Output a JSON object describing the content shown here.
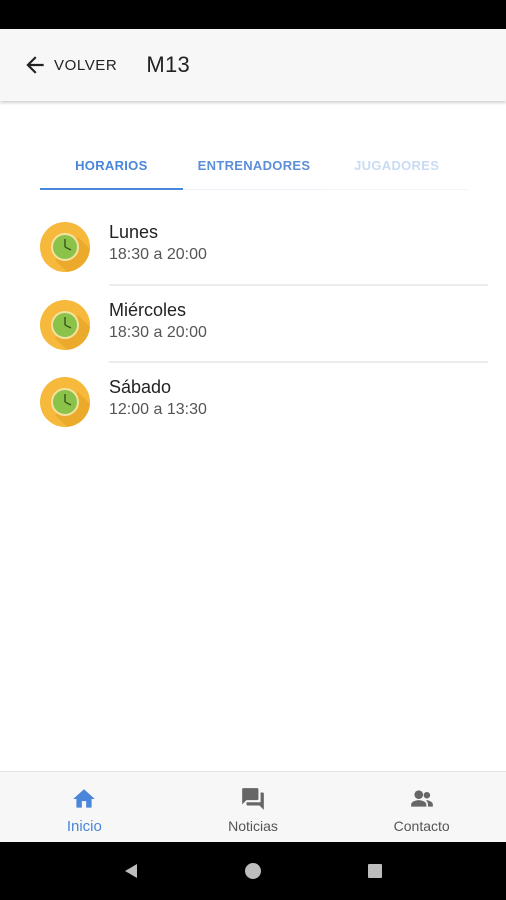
{
  "header": {
    "back_label": "VOLVER",
    "title": "M13",
    "back_icon": "arrow-left-icon"
  },
  "tabs": [
    {
      "label": "HORARIOS",
      "state": "active"
    },
    {
      "label": "ENTRENADORES",
      "state": "inactive"
    },
    {
      "label": "JUGADORES",
      "state": "faded"
    }
  ],
  "schedule": [
    {
      "day": "Lunes",
      "time": "18:30 a 20:00",
      "icon": "clock-icon"
    },
    {
      "day": "Miércoles",
      "time": "18:30 a 20:00",
      "icon": "clock-icon"
    },
    {
      "day": "Sábado",
      "time": "12:00 a 13:30",
      "icon": "clock-icon"
    }
  ],
  "bottom_nav": [
    {
      "label": "Inicio",
      "icon": "home-icon",
      "active": true
    },
    {
      "label": "Noticias",
      "icon": "chat-bubbles-icon",
      "active": false
    },
    {
      "label": "Contacto",
      "icon": "contacts-icon",
      "active": false
    }
  ],
  "colors": {
    "accent": "#4a86d9",
    "clock_orange": "#f6b93b",
    "clock_face": "#8bc34a",
    "app_bar": "#f7f7f7"
  }
}
